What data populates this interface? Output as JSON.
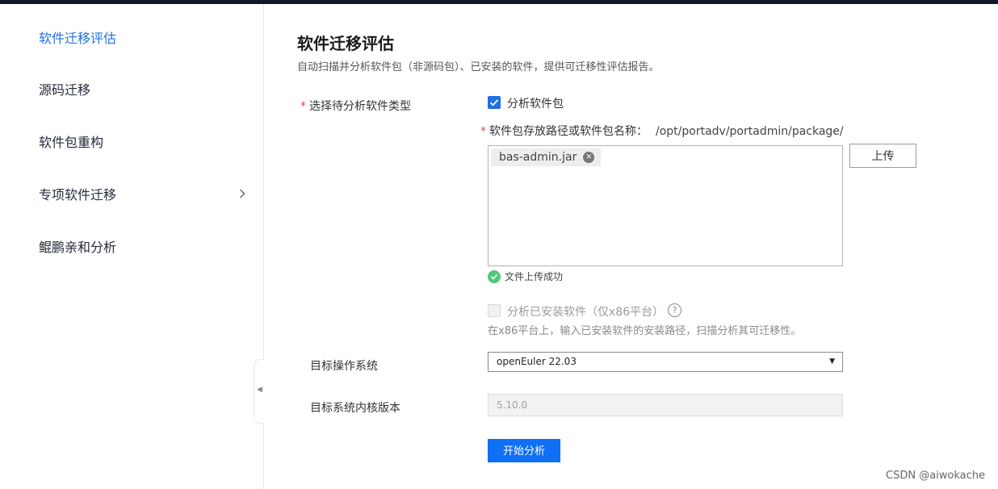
{
  "sidebar": {
    "items": [
      {
        "label": "软件迁移评估",
        "active": true
      },
      {
        "label": "源码迁移"
      },
      {
        "label": "软件包重构"
      },
      {
        "label": "专项软件迁移",
        "has_submenu": true
      },
      {
        "label": "鲲鹏亲和分析"
      }
    ]
  },
  "page": {
    "title": "软件迁移评估",
    "description": "自动扫描并分析软件包（非源码包）、已安装的软件，提供可迁移性评估报告。"
  },
  "form": {
    "type_label": "选择待分析软件类型",
    "required_mark": "*",
    "package_checkbox": {
      "label": "分析软件包",
      "checked": true
    },
    "path_label": "软件包存放路径或软件包名称：",
    "path_value": "/opt/portadv/portadmin/package/",
    "uploaded_file": "bas-admin.jar",
    "upload_button": "上传",
    "upload_status": "文件上传成功",
    "installed_checkbox": {
      "label": "分析已安装软件（仅x86平台）",
      "checked": false,
      "disabled": true
    },
    "installed_hint": "在x86平台上，输入已安装软件的安装路径，扫描分析其可迁移性。",
    "os_label": "目标操作系统",
    "os_value": "openEuler 22.03",
    "kernel_label": "目标系统内核版本",
    "kernel_value": "5.10.0",
    "submit_button": "开始分析"
  },
  "watermark": "CSDN @aiwokache",
  "colors": {
    "accent": "#1f6fe5",
    "primary_button": "#0f6ff5",
    "required": "#e54545",
    "success": "#50c878",
    "topbar": "#111827"
  }
}
